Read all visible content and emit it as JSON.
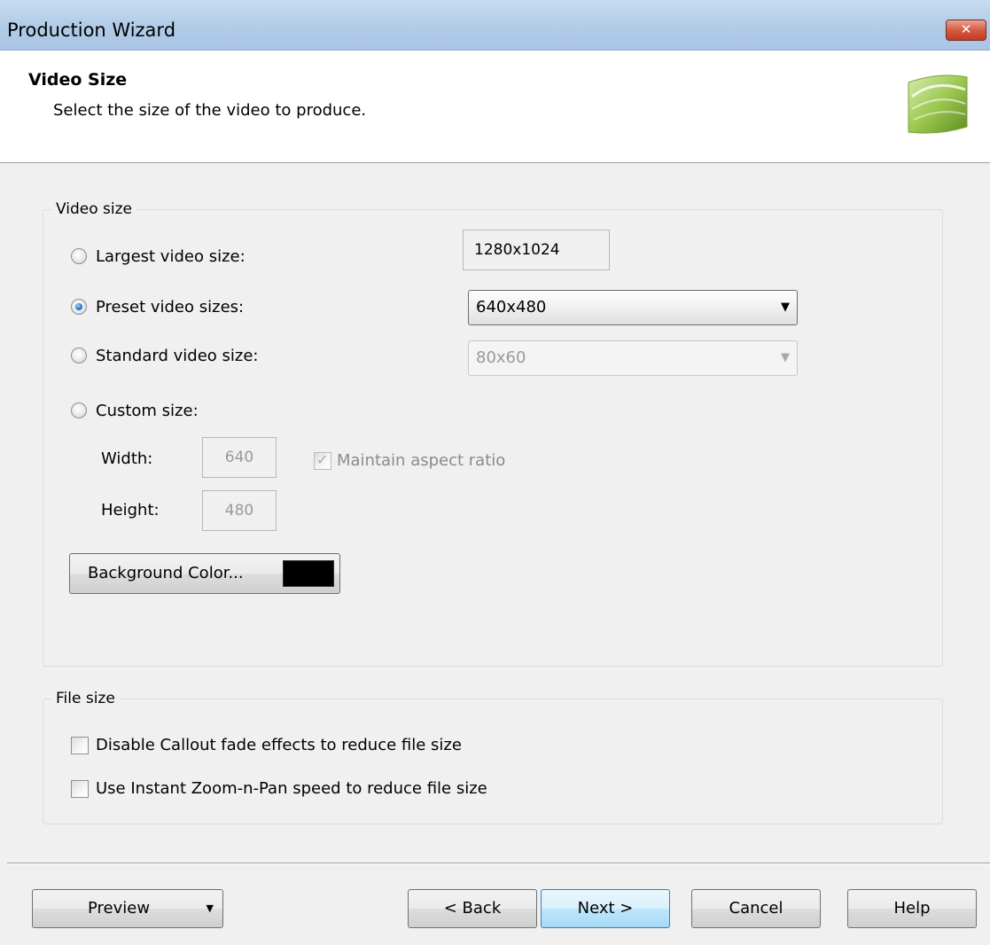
{
  "window": {
    "title": "Production Wizard",
    "close_glyph": "✕"
  },
  "header": {
    "title": "Video Size",
    "subtitle": "Select the size of the video to produce.",
    "logo_icon": "wizard-page-icon"
  },
  "video_size_group": {
    "label": "Video size",
    "options": {
      "largest": {
        "label": "Largest video size:",
        "value": "1280x1024",
        "checked": false
      },
      "preset": {
        "label": "Preset video sizes:",
        "value": "640x480",
        "checked": true
      },
      "standard": {
        "label": "Standard video size:",
        "value": "80x60",
        "checked": false
      },
      "custom": {
        "label": "Custom size:",
        "checked": false
      }
    },
    "width_label": "Width:",
    "width_value": "640",
    "height_label": "Height:",
    "height_value": "480",
    "aspect_label": "Maintain aspect ratio",
    "aspect_checked": true,
    "background_button": "Background Color...",
    "background_color": "#000000"
  },
  "file_size_group": {
    "label": "File size",
    "disable_fade": "Disable Callout fade effects to reduce file size",
    "instant_zoom": "Use Instant Zoom-n-Pan speed to reduce file size"
  },
  "footer": {
    "preview": "Preview",
    "back": "< Back",
    "next": "Next >",
    "cancel": "Cancel",
    "help": "Help"
  }
}
